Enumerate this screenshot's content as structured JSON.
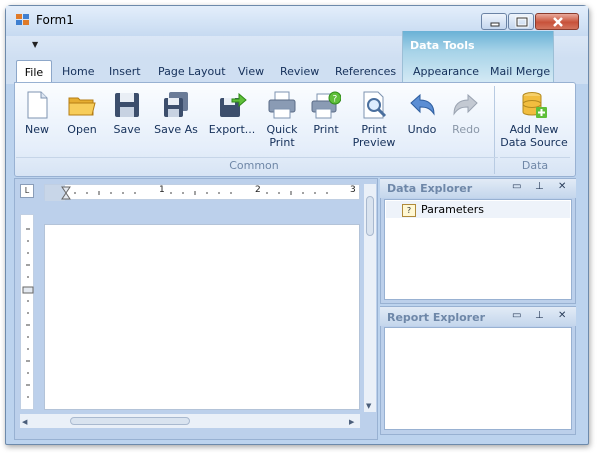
{
  "window": {
    "title": "Form1"
  },
  "ribbon": {
    "tabs": [
      "File",
      "Home",
      "Insert",
      "Page Layout",
      "View",
      "Review",
      "References"
    ],
    "contextual": {
      "title": "Data Tools",
      "tabs": [
        "Appearance",
        "Mail Merge"
      ]
    },
    "common": {
      "group_label": "Common",
      "buttons": [
        {
          "label": "New",
          "icon": "new-page-icon"
        },
        {
          "label": "Open",
          "icon": "folder-icon"
        },
        {
          "label": "Save",
          "icon": "floppy-icon"
        },
        {
          "label": "Save As",
          "icon": "floppy-stack-icon"
        },
        {
          "label": "Export...",
          "icon": "export-icon"
        },
        {
          "label_line1": "Quick",
          "label_line2": "Print",
          "icon": "printer-icon"
        },
        {
          "label": "Print",
          "icon": "printer-help-icon"
        },
        {
          "label_line1": "Print",
          "label_line2": "Preview",
          "icon": "print-preview-icon"
        },
        {
          "label": "Undo",
          "icon": "undo-icon"
        },
        {
          "label": "Redo",
          "icon": "redo-icon"
        }
      ]
    },
    "data": {
      "group_label": "Data",
      "add_source": {
        "label_line1": "Add New",
        "label_line2": "Data Source",
        "icon": "database-add-icon"
      }
    }
  },
  "ruler": {
    "corner_label": "L",
    "numbers": [
      "1",
      "2",
      "3"
    ]
  },
  "data_explorer": {
    "title": "Data Explorer",
    "items": [
      {
        "label": "Parameters",
        "icon": "parameters-icon",
        "glyph": "?"
      }
    ]
  },
  "report_explorer": {
    "title": "Report Explorer"
  },
  "colors": {
    "ribbon_bg": "#e5eefa",
    "panel_title": "#6e87a8",
    "context_tab": "#6ab1d6",
    "close_red": "#c8523a"
  }
}
